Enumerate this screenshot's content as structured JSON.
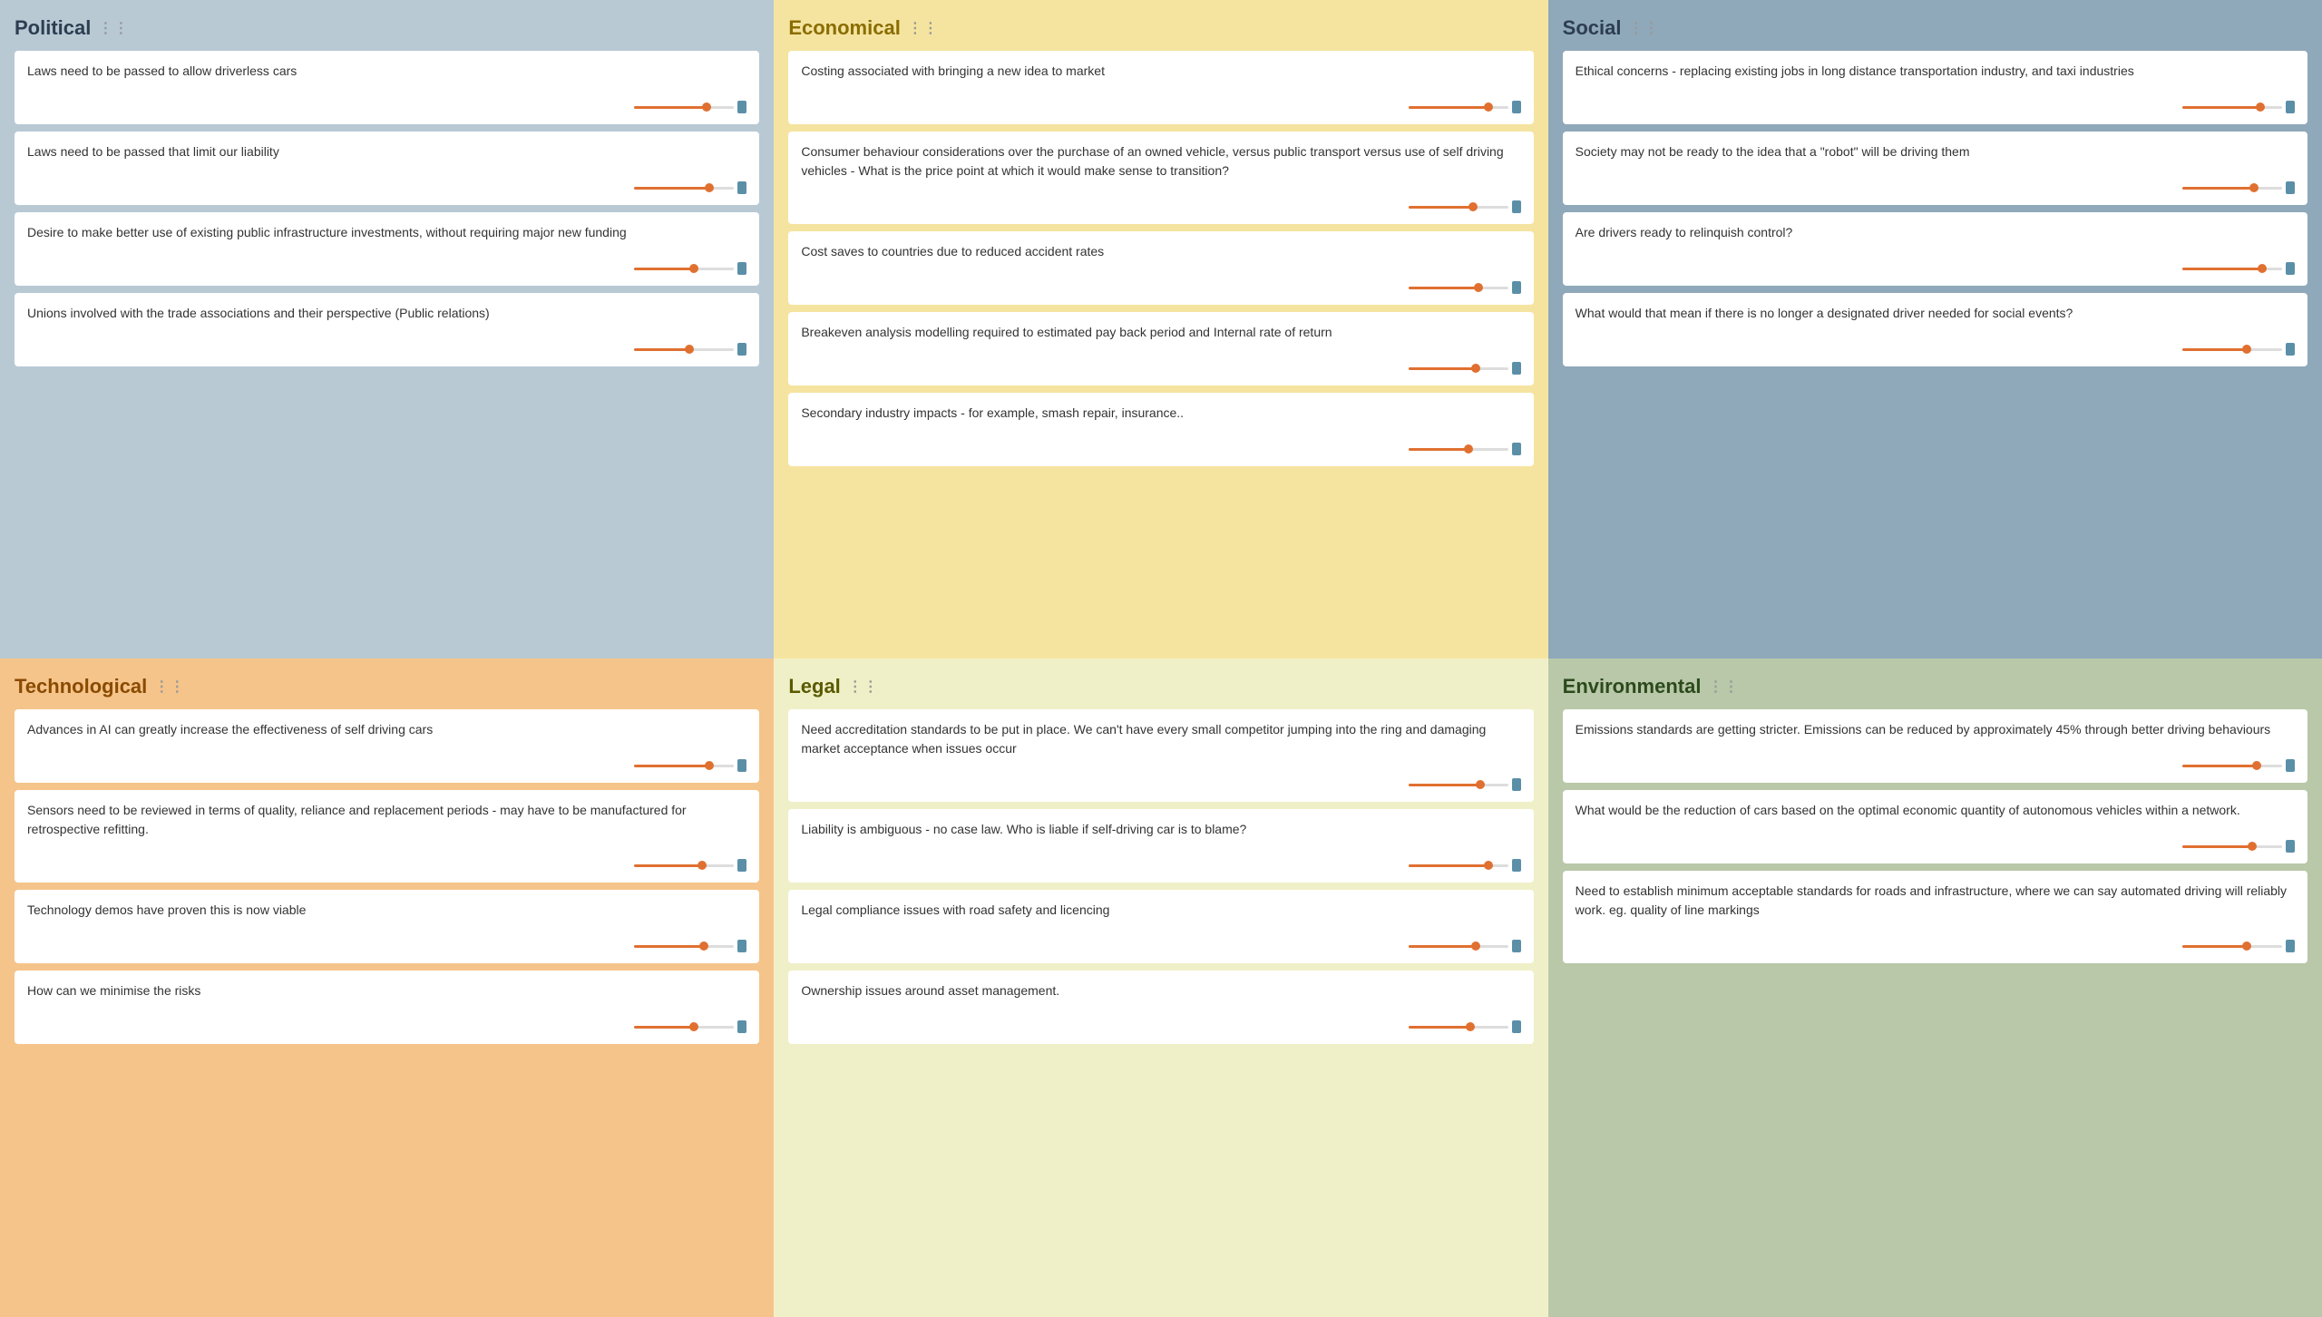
{
  "sections": {
    "political": {
      "title": "Political",
      "bg": "political",
      "cards": [
        {
          "text": "Laws need to be passed to allow driverless cars",
          "fill": 72
        },
        {
          "text": "Laws need to be passed that limit our liability",
          "fill": 75
        },
        {
          "text": "Desire to make better use of existing public infrastructure investments, without requiring major new funding",
          "fill": 60
        },
        {
          "text": "Unions involved with the trade associations and their perspective (Public relations)",
          "fill": 55
        }
      ]
    },
    "economical": {
      "title": "Economical",
      "bg": "economical",
      "cards": [
        {
          "text": "Costing associated with bringing a new idea to market",
          "fill": 80
        },
        {
          "text": "Consumer behaviour considerations over the purchase of an owned vehicle, versus public transport versus use of self driving vehicles - What is the price point at which it would make sense to transition?",
          "fill": 65
        },
        {
          "text": "Cost saves to countries due to reduced accident rates",
          "fill": 70
        },
        {
          "text": "Breakeven analysis modelling required to estimated pay back period and Internal rate of return",
          "fill": 68
        },
        {
          "text": "Secondary industry impacts - for example, smash repair, insurance..",
          "fill": 60
        }
      ]
    },
    "social": {
      "title": "Social",
      "bg": "social",
      "cards": [
        {
          "text": "Ethical concerns - replacing existing jobs in long distance transportation industry, and taxi industries",
          "fill": 78
        },
        {
          "text": "Society may not be ready to the idea that a \"robot\" will be driving them",
          "fill": 72
        },
        {
          "text": "Are drivers ready to relinquish control?",
          "fill": 80
        },
        {
          "text": "What would that mean if there is no longer a designated driver needed for social events?",
          "fill": 65
        }
      ]
    },
    "technological": {
      "title": "Technological",
      "bg": "technological",
      "cards": [
        {
          "text": "Advances in AI can greatly increase the effectiveness of self driving cars",
          "fill": 75
        },
        {
          "text": "Sensors need to be reviewed in terms of quality, reliance and replacement periods - may have to be manufactured for retrospective refitting.",
          "fill": 68
        },
        {
          "text": "Technology demos have proven this is now viable",
          "fill": 70
        },
        {
          "text": "How can we minimise the risks",
          "fill": 60
        }
      ]
    },
    "legal": {
      "title": "Legal",
      "bg": "legal",
      "cards": [
        {
          "text": "Need accreditation standards to be put in place. We can't have every small competitor jumping into the ring and damaging market acceptance when issues occur",
          "fill": 72
        },
        {
          "text": "Liability is ambiguous - no case law. Who is liable if self-driving car is to blame?",
          "fill": 80
        },
        {
          "text": "Legal compliance issues with road safety and licencing",
          "fill": 68
        },
        {
          "text": "Ownership issues around asset management.",
          "fill": 62
        }
      ]
    },
    "environmental": {
      "title": "Environmental",
      "bg": "environmental",
      "cards": [
        {
          "text": "Emissions standards are getting stricter. Emissions can be reduced by approximately 45% through better driving behaviours",
          "fill": 75
        },
        {
          "text": "What would be the reduction of cars based on the optimal economic quantity of autonomous vehicles within a network.",
          "fill": 70
        },
        {
          "text": "Need to establish minimum acceptable standards for roads and infrastructure, where we can say automated driving will reliably work. eg. quality of line markings",
          "fill": 65
        }
      ]
    }
  }
}
